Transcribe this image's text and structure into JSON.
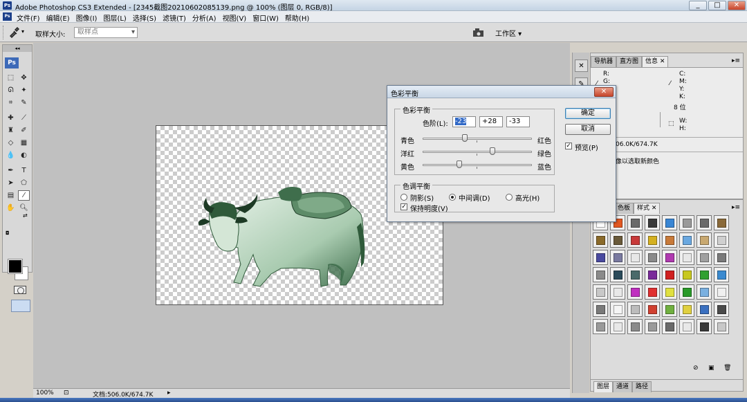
{
  "window": {
    "title": "Adobe Photoshop CS3 Extended - [2345截图20210602085139.png @ 100% (图层 0, RGB/8)]",
    "app_badge": "Ps",
    "controls": [
      "_",
      "□",
      "✕"
    ]
  },
  "menu": [
    "文件(F)",
    "编辑(E)",
    "图像(I)",
    "图层(L)",
    "选择(S)",
    "滤镜(T)",
    "分析(A)",
    "视图(V)",
    "窗口(W)",
    "帮助(H)"
  ],
  "options_bar": {
    "sample_size_label": "取样大小:",
    "sample_size_value": "取样点",
    "workspace_label": "工作区 ▾"
  },
  "toolbox": {
    "header": "◂◂",
    "badge": "Ps"
  },
  "status_bar": {
    "zoom": "100%",
    "doc_info": "文档:506.0K/674.7K"
  },
  "info_panel": {
    "tabs": [
      "导航器",
      "直方图",
      "信息"
    ],
    "active_tab": "信息",
    "rgb_labels": [
      "R:",
      "G:",
      "B:"
    ],
    "cmyk_labels": [
      "C:",
      "M:",
      "Y:",
      "K:"
    ],
    "bit_depth": "8 位",
    "wh_labels": [
      "W:",
      "H:"
    ],
    "doc_size": "06.0K/674.7K",
    "hint": "像以选取新颜色"
  },
  "styles_panel": {
    "tabs": [
      "色板",
      "样式"
    ],
    "active_tab": "样式",
    "swatch_colors": [
      "#ffffff",
      "#e25822",
      "#6a6a6a",
      "#3a3a3a",
      "#3a86d4",
      "#9a9a9a",
      "#6a6a6a",
      "#8a6a3a",
      "#8a6a2a",
      "#6a5a3a",
      "#c83a3a",
      "#d4b020",
      "#c87a3a",
      "#6aa8e0",
      "#c8a870",
      "#cfcfcf",
      "#4a4aa0",
      "#7a7aa0",
      "#e8e8e8",
      "#8a8a8a",
      "#b03ab0",
      "#e8e8e8",
      "#a0a0a0",
      "#7a7a7a",
      "#8a8a8a",
      "#2a4a5a",
      "#4a6a6a",
      "#7a2a9a",
      "#d02020",
      "#c8c820",
      "#30a030",
      "#3a8ad0",
      "#c8c8c8",
      "#e8e8e8",
      "#c030c0",
      "#e03030",
      "#e0e040",
      "#2a9a2a",
      "#7ab0e0",
      "#f0f0f0",
      "#7a7a7a",
      "#f5f5f5",
      "#bcbcbc",
      "#d04030",
      "#70b040",
      "#e0d040",
      "#3a70c0",
      "#4a4a4a",
      "#9a9a9a",
      "#e8e8e8",
      "#8a8a8a",
      "#9a9a9a",
      "#6a6a6a",
      "#e8e8e8",
      "#3a3a3a",
      "#c8c8c8"
    ]
  },
  "layers_tabs": [
    "图层",
    "通道",
    "路径"
  ],
  "dialog": {
    "title": "色彩平衡",
    "group1_label": "色彩平衡",
    "levels_label": "色阶(L):",
    "levels": [
      "-23",
      "+28",
      "-33"
    ],
    "sliders": [
      {
        "left": "青色",
        "right": "红色",
        "value": -23
      },
      {
        "left": "洋红",
        "right": "绿色",
        "value": 28
      },
      {
        "left": "黄色",
        "right": "蓝色",
        "value": -33
      }
    ],
    "group2_label": "色调平衡",
    "tones": [
      "阴影(S)",
      "中间调(D)",
      "高光(H)"
    ],
    "selected_tone": "中间调(D)",
    "preserve_luminosity": "保持明度(V)",
    "preserve_checked": true,
    "ok": "确定",
    "cancel": "取消",
    "preview": "预览(P)",
    "preview_checked": true
  }
}
